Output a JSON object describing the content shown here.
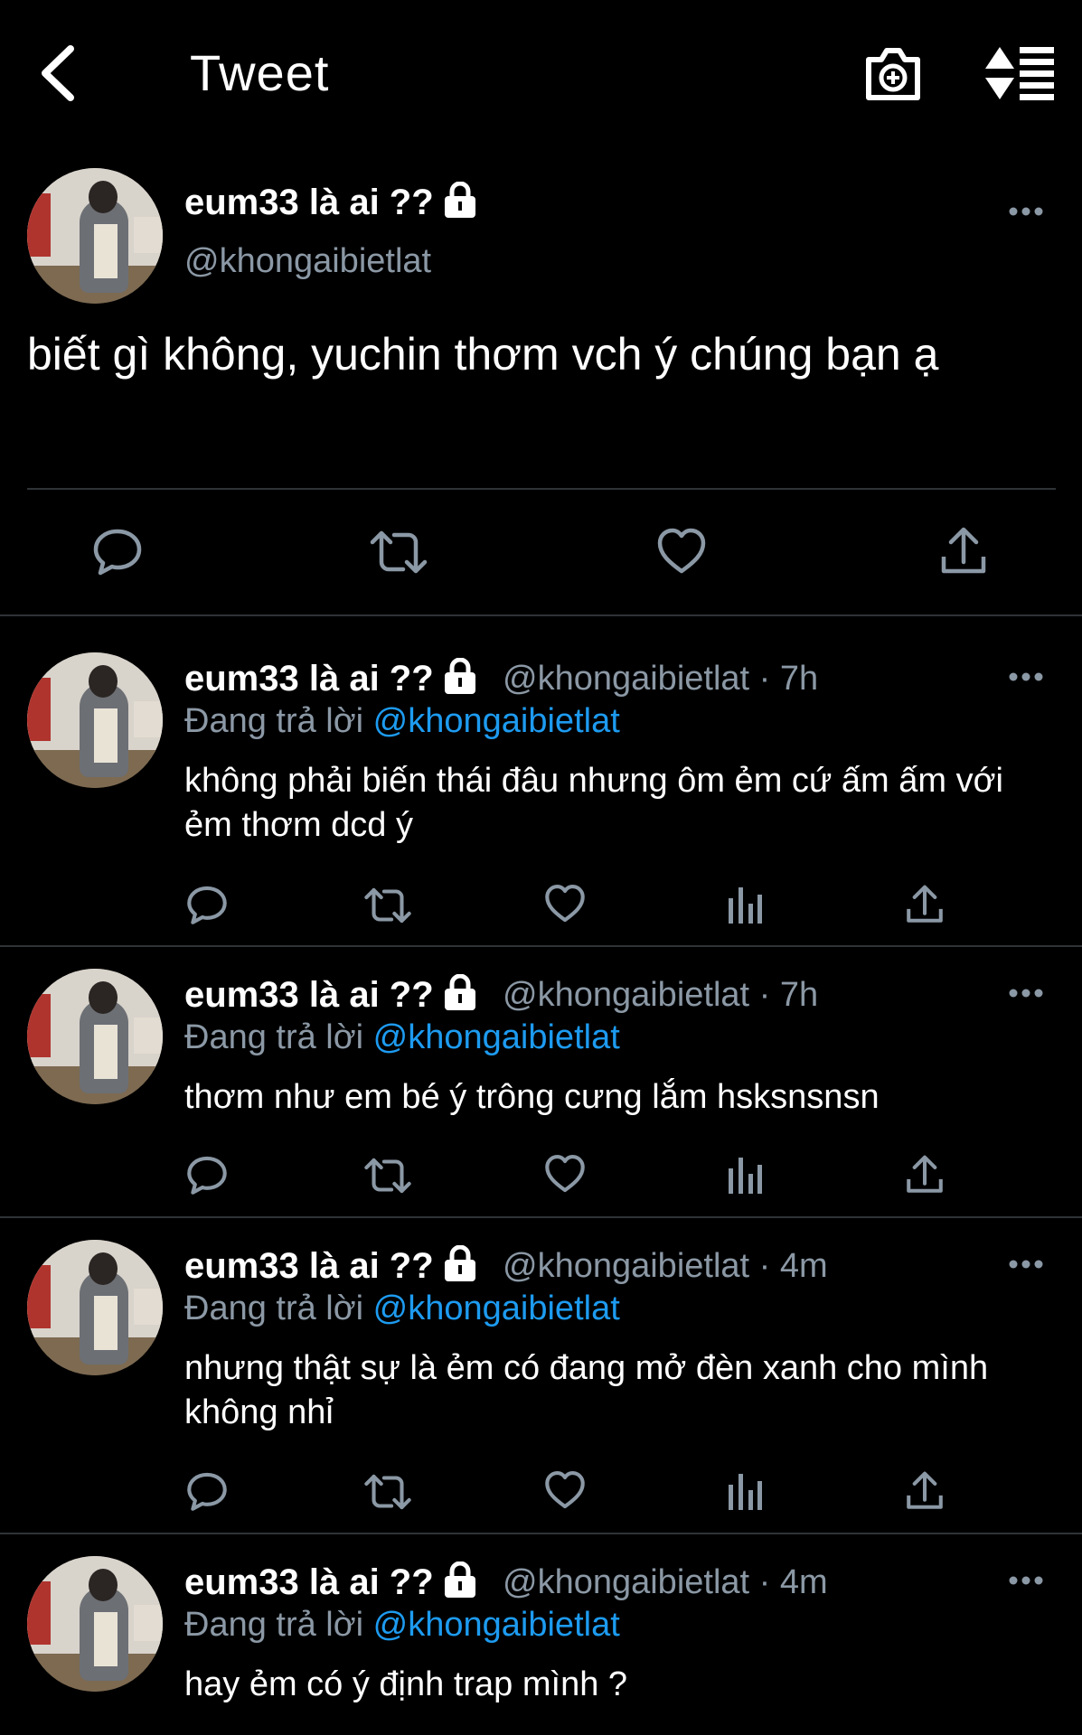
{
  "header": {
    "title": "Tweet"
  },
  "main_tweet": {
    "display_name": "eum33 là ai ??",
    "handle": "@khongaibietlat",
    "text": "biết gì không, yuchin thơm vch ý chúng bạn ạ"
  },
  "replies": [
    {
      "display_name": "eum33 là ai ??",
      "meta": "@khongaibietlat · 7h",
      "replying_label": "Đang trả lời",
      "replying_to": "@khongaibietlat",
      "text": "không phải biến thái đâu nhưng ôm ẻm cứ ấm ấm với ẻm thơm dcd ý"
    },
    {
      "display_name": "eum33 là ai ??",
      "meta": "@khongaibietlat · 7h",
      "replying_label": "Đang trả lời",
      "replying_to": "@khongaibietlat",
      "text": "thơm như em bé ý trông cưng lắm hsksnsnsn"
    },
    {
      "display_name": "eum33 là ai ??",
      "meta": "@khongaibietlat · 4m",
      "replying_label": "Đang trả lời",
      "replying_to": "@khongaibietlat",
      "text": "nhưng thật sự là ẻm có đang mở đèn xanh cho mình không nhỉ"
    },
    {
      "display_name": "eum33 là ai ??",
      "meta": "@khongaibietlat · 4m",
      "replying_label": "Đang trả lời",
      "replying_to": "@khongaibietlat",
      "text": "hay ẻm có ý định trap mình ?"
    }
  ],
  "icons": {
    "back": "chevron-left-icon",
    "camera": "camera-plus-icon",
    "sort": "sort-list-icon",
    "lock": "lock-icon",
    "more": "more-dots-icon",
    "reply": "reply-bubble-icon",
    "retweet": "retweet-icon",
    "like": "heart-icon",
    "views": "analytics-bars-icon",
    "share": "share-upload-icon"
  },
  "colors": {
    "background": "#000000",
    "text": "#ffffff",
    "secondary": "#8b98a5",
    "link": "#1d9bf0",
    "divider": "#2f3336"
  }
}
